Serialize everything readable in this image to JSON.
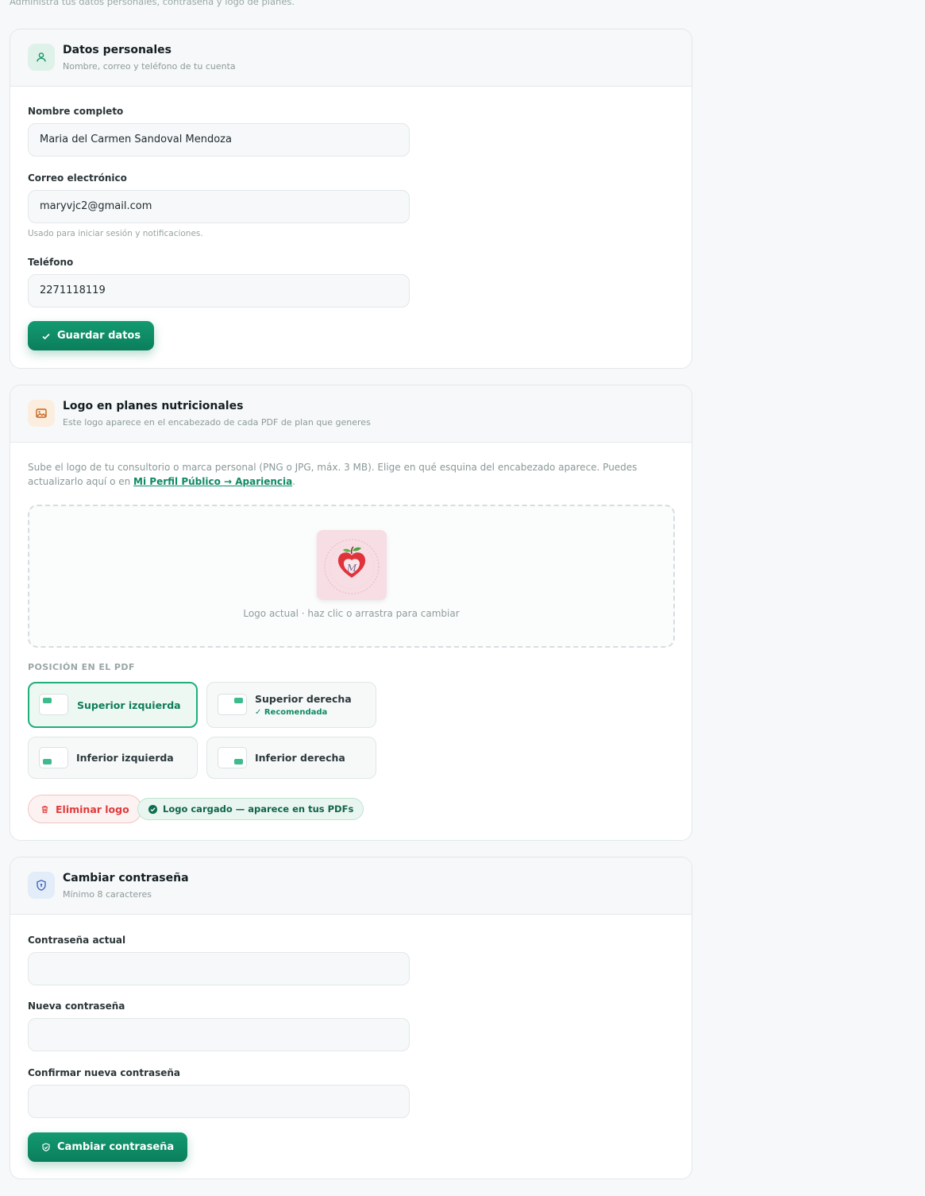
{
  "page": {
    "subtitle": "Administra tus datos personales, contraseña y logo de planes."
  },
  "personal": {
    "title": "Datos personales",
    "subtitle": "Nombre, correo y teléfono de tu cuenta",
    "icon": "user-icon",
    "fields": {
      "name_label": "Nombre completo",
      "name_value": "Maria del Carmen Sandoval Mendoza",
      "email_label": "Correo electrónico",
      "email_value": "maryvjc2@gmail.com",
      "email_hint": "Usado para iniciar sesión y notificaciones.",
      "phone_label": "Teléfono",
      "phone_value": "2271118119"
    },
    "save_label": "Guardar datos"
  },
  "logo": {
    "title": "Logo en planes nutricionales",
    "subtitle": "Este logo aparece en el encabezado de cada PDF de plan que generes",
    "icon": "image-icon",
    "description": "Sube el logo de tu consultorio o marca personal (PNG o JPG, máx. 3 MB). Elige en qué esquina del encabezado aparece. Puedes actualizarlo aquí o en ",
    "description_link": "Mi Perfil Público → Apariencia",
    "description_end": ".",
    "dropzone_caption": "Logo actual · haz clic o arrastra para cambiar",
    "position_heading": "POSICIÓN EN EL PDF",
    "positions": [
      {
        "label": "Superior izquierda",
        "selected": true,
        "note": ""
      },
      {
        "label": "Superior derecha",
        "selected": false,
        "note": "✓ Recomendada"
      },
      {
        "label": "Inferior izquierda",
        "selected": false,
        "note": ""
      },
      {
        "label": "Inferior derecha",
        "selected": false,
        "note": ""
      }
    ],
    "delete_label": "Eliminar logo",
    "status_label": "Logo cargado — aparece en tus PDFs"
  },
  "password": {
    "title": "Cambiar contraseña",
    "subtitle": "Mínimo 8 caracteres",
    "icon": "shield-icon",
    "current_label": "Contraseña actual",
    "new_label": "Nueva contraseña",
    "confirm_label": "Confirmar nueva contraseña",
    "submit_label": "Cambiar contraseña"
  },
  "colors": {
    "accent": "#0e8a63",
    "danger": "#e03a3a",
    "background": "#f6f8f9"
  }
}
